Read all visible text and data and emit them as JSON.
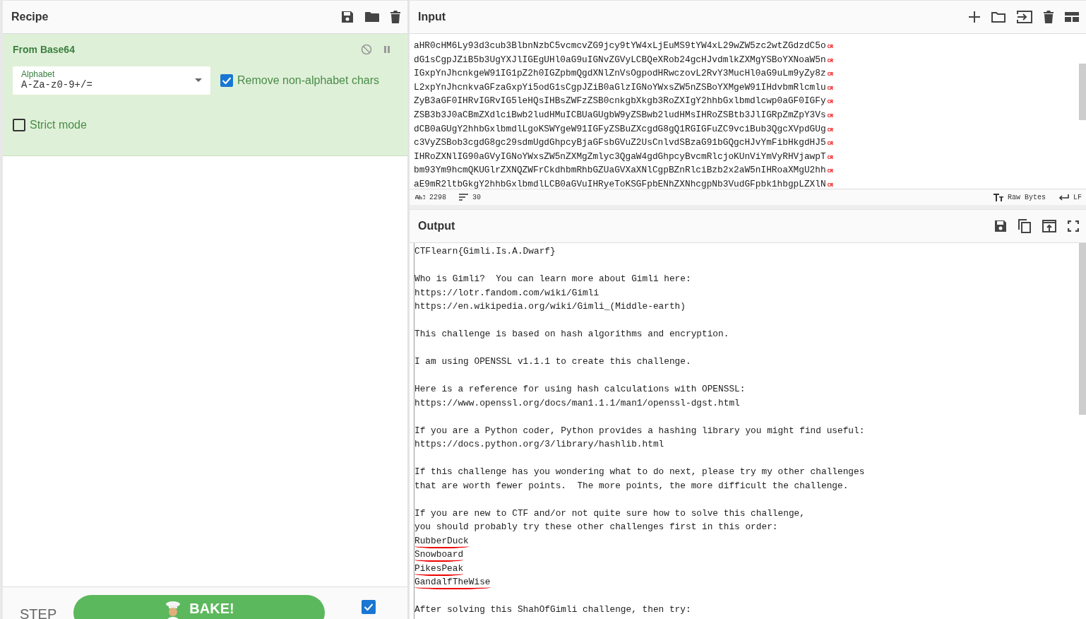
{
  "recipe": {
    "title": "Recipe",
    "operation": {
      "title": "From Base64",
      "alphabet": {
        "label": "Alphabet",
        "value": "A-Za-z0-9+/="
      },
      "options": [
        {
          "label": "Remove non-alphabet chars",
          "checked": true
        },
        {
          "label": "Strict mode",
          "checked": false
        }
      ]
    },
    "bake": {
      "step": "STEP",
      "button": "BAKE!",
      "auto_bake_checked": true
    }
  },
  "input": {
    "title": "Input",
    "lines": [
      {
        "text": "aHR0cHM6Ly93d3cub3BlbnNzbC5vcmcvZG9jcy9tYW4xLjEuMS9tYW4xL29wZW5zc2wtZGdzdC5o",
        "end": "CR"
      },
      {
        "text": "dG1sCgpJZiB5b3UgYXJlIGEgUHl0aG9uIGNvZGVyLCBQeXRob24gcHJvdmlkZXMgYSBoYXNoaW5n",
        "end": "CR"
      },
      {
        "text": "IGxpYnJhcnkgeW91IG1pZ2h0IGZpbmQgdXNlZnVsOgpodHRwczovL2RvY3MucHl0aG9uLm9yZy8z",
        "end": "CR"
      },
      {
        "text": "L2xpYnJhcnkvaGFzaGxpYi5odG1sCgpJZiB0aGlzIGNoYWxsZW5nZSBoYXMgeW91IHdvbmRlcmlu",
        "end": "CR"
      },
      {
        "text": "ZyB3aGF0IHRvIGRvIG5leHQsIHBsZWFzZSB0cnkgbXkgb3RoZXIgY2hhbGxlbmdlcwp0aGF0IGFy",
        "end": "CR"
      },
      {
        "text": "ZSB3b3J0aCBmZXdlciBwb2ludHMuICBUaGUgbW9yZSBwb2ludHMsIHRoZSBtb3JlIGRpZmZpY3Vs",
        "end": "CR"
      },
      {
        "text": "dCB0aGUgY2hhbGxlbmdlLgoKSWYgeW91IGFyZSBuZXcgdG8gQ1RGIGFuZC9vciBub3QgcXVpdGUg",
        "end": "CR"
      },
      {
        "text": "c3VyZSBob3cgdG8gc29sdmUgdGhpcyBjaGFsbGVuZ2UsCnlvdSBzaG91bGQgcHJvYmFibHkgdHJ5",
        "end": "CR"
      },
      {
        "text": "IHRoZXNlIG90aGVyIGNoYWxsZW5nZXMgZmlyc3QgaW4gdGhpcyBvcmRlcjoKUnViYmVyRHVjawpT",
        "end": "CR"
      },
      {
        "text": "bm93Ym9hcmQKUGlrZXNQZWFrCkdhbmRhbGZUaGVXaXNlCgpBZnRlciBzb2x2aW5nIHRoaXMgU2hh",
        "end": "CR"
      },
      {
        "text": "aE9mR2ltbGkgY2hhbGxlbmdlLCB0aGVuIHRyeToKSGFpbENhZXNhcgpNb3VudGFpbk1hbgpLZXlN",
        "end": "CR"
      }
    ],
    "status": {
      "chars": "2298",
      "lines": "30",
      "encoding": "Raw Bytes",
      "eol": "LF"
    }
  },
  "output": {
    "title": "Output",
    "paragraphs": [
      {
        "lines": [
          {
            "text": "CTFlearn{Gimli.Is.A.Dwarf}",
            "underlined": false
          }
        ]
      },
      {
        "lines": [
          {
            "text": "Who is Gimli?  You can learn more about Gimli here:",
            "underlined": false
          },
          {
            "text": "https://lotr.fandom.com/wiki/Gimli",
            "underlined": false
          },
          {
            "text": "https://en.wikipedia.org/wiki/Gimli_(Middle-earth)",
            "underlined": false
          }
        ]
      },
      {
        "lines": [
          {
            "text": "This challenge is based on hash algorithms and encryption.",
            "underlined": false
          }
        ]
      },
      {
        "lines": [
          {
            "text": "I am using OPENSSL v1.1.1 to create this challenge.",
            "underlined": false
          }
        ]
      },
      {
        "lines": [
          {
            "text": "Here is a reference for using hash calculations with OPENSSL:",
            "underlined": false
          },
          {
            "text": "https://www.openssl.org/docs/man1.1.1/man1/openssl-dgst.html",
            "underlined": false
          }
        ]
      },
      {
        "lines": [
          {
            "text": "If you are a Python coder, Python provides a hashing library you might find useful:",
            "underlined": false
          },
          {
            "text": "https://docs.python.org/3/library/hashlib.html",
            "underlined": false
          }
        ]
      },
      {
        "lines": [
          {
            "text": "If this challenge has you wondering what to do next, please try my other challenges",
            "underlined": false
          },
          {
            "text": "that are worth fewer points.  The more points, the more difficult the challenge.",
            "underlined": false
          }
        ]
      },
      {
        "lines": [
          {
            "text": "If you are new to CTF and/or not quite sure how to solve this challenge,",
            "underlined": false
          },
          {
            "text": "you should probably try these other challenges first in this order:",
            "underlined": false
          },
          {
            "text": "RubberDuck",
            "underlined": true
          },
          {
            "text": "Snowboard",
            "underlined": true
          },
          {
            "text": "PikesPeak",
            "underlined": true
          },
          {
            "text": "GandalfTheWise",
            "underlined": true
          }
        ]
      },
      {
        "lines": [
          {
            "text": "After solving this ShahOfGimli challenge, then try:",
            "underlined": false
          }
        ]
      }
    ]
  }
}
